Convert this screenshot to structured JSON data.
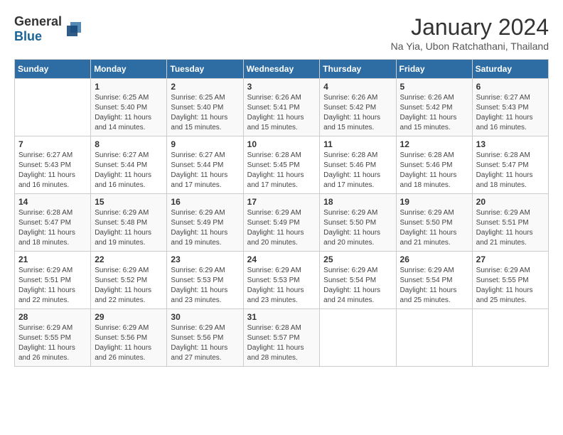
{
  "header": {
    "logo_general": "General",
    "logo_blue": "Blue",
    "title": "January 2024",
    "location": "Na Yia, Ubon Ratchathani, Thailand"
  },
  "calendar": {
    "days_of_week": [
      "Sunday",
      "Monday",
      "Tuesday",
      "Wednesday",
      "Thursday",
      "Friday",
      "Saturday"
    ],
    "weeks": [
      [
        {
          "day": "",
          "info": ""
        },
        {
          "day": "1",
          "info": "Sunrise: 6:25 AM\nSunset: 5:40 PM\nDaylight: 11 hours\nand 14 minutes."
        },
        {
          "day": "2",
          "info": "Sunrise: 6:25 AM\nSunset: 5:40 PM\nDaylight: 11 hours\nand 15 minutes."
        },
        {
          "day": "3",
          "info": "Sunrise: 6:26 AM\nSunset: 5:41 PM\nDaylight: 11 hours\nand 15 minutes."
        },
        {
          "day": "4",
          "info": "Sunrise: 6:26 AM\nSunset: 5:42 PM\nDaylight: 11 hours\nand 15 minutes."
        },
        {
          "day": "5",
          "info": "Sunrise: 6:26 AM\nSunset: 5:42 PM\nDaylight: 11 hours\nand 15 minutes."
        },
        {
          "day": "6",
          "info": "Sunrise: 6:27 AM\nSunset: 5:43 PM\nDaylight: 11 hours\nand 16 minutes."
        }
      ],
      [
        {
          "day": "7",
          "info": "Sunrise: 6:27 AM\nSunset: 5:43 PM\nDaylight: 11 hours\nand 16 minutes."
        },
        {
          "day": "8",
          "info": "Sunrise: 6:27 AM\nSunset: 5:44 PM\nDaylight: 11 hours\nand 16 minutes."
        },
        {
          "day": "9",
          "info": "Sunrise: 6:27 AM\nSunset: 5:44 PM\nDaylight: 11 hours\nand 17 minutes."
        },
        {
          "day": "10",
          "info": "Sunrise: 6:28 AM\nSunset: 5:45 PM\nDaylight: 11 hours\nand 17 minutes."
        },
        {
          "day": "11",
          "info": "Sunrise: 6:28 AM\nSunset: 5:46 PM\nDaylight: 11 hours\nand 17 minutes."
        },
        {
          "day": "12",
          "info": "Sunrise: 6:28 AM\nSunset: 5:46 PM\nDaylight: 11 hours\nand 18 minutes."
        },
        {
          "day": "13",
          "info": "Sunrise: 6:28 AM\nSunset: 5:47 PM\nDaylight: 11 hours\nand 18 minutes."
        }
      ],
      [
        {
          "day": "14",
          "info": "Sunrise: 6:28 AM\nSunset: 5:47 PM\nDaylight: 11 hours\nand 18 minutes."
        },
        {
          "day": "15",
          "info": "Sunrise: 6:29 AM\nSunset: 5:48 PM\nDaylight: 11 hours\nand 19 minutes."
        },
        {
          "day": "16",
          "info": "Sunrise: 6:29 AM\nSunset: 5:49 PM\nDaylight: 11 hours\nand 19 minutes."
        },
        {
          "day": "17",
          "info": "Sunrise: 6:29 AM\nSunset: 5:49 PM\nDaylight: 11 hours\nand 20 minutes."
        },
        {
          "day": "18",
          "info": "Sunrise: 6:29 AM\nSunset: 5:50 PM\nDaylight: 11 hours\nand 20 minutes."
        },
        {
          "day": "19",
          "info": "Sunrise: 6:29 AM\nSunset: 5:50 PM\nDaylight: 11 hours\nand 21 minutes."
        },
        {
          "day": "20",
          "info": "Sunrise: 6:29 AM\nSunset: 5:51 PM\nDaylight: 11 hours\nand 21 minutes."
        }
      ],
      [
        {
          "day": "21",
          "info": "Sunrise: 6:29 AM\nSunset: 5:51 PM\nDaylight: 11 hours\nand 22 minutes."
        },
        {
          "day": "22",
          "info": "Sunrise: 6:29 AM\nSunset: 5:52 PM\nDaylight: 11 hours\nand 22 minutes."
        },
        {
          "day": "23",
          "info": "Sunrise: 6:29 AM\nSunset: 5:53 PM\nDaylight: 11 hours\nand 23 minutes."
        },
        {
          "day": "24",
          "info": "Sunrise: 6:29 AM\nSunset: 5:53 PM\nDaylight: 11 hours\nand 23 minutes."
        },
        {
          "day": "25",
          "info": "Sunrise: 6:29 AM\nSunset: 5:54 PM\nDaylight: 11 hours\nand 24 minutes."
        },
        {
          "day": "26",
          "info": "Sunrise: 6:29 AM\nSunset: 5:54 PM\nDaylight: 11 hours\nand 25 minutes."
        },
        {
          "day": "27",
          "info": "Sunrise: 6:29 AM\nSunset: 5:55 PM\nDaylight: 11 hours\nand 25 minutes."
        }
      ],
      [
        {
          "day": "28",
          "info": "Sunrise: 6:29 AM\nSunset: 5:55 PM\nDaylight: 11 hours\nand 26 minutes."
        },
        {
          "day": "29",
          "info": "Sunrise: 6:29 AM\nSunset: 5:56 PM\nDaylight: 11 hours\nand 26 minutes."
        },
        {
          "day": "30",
          "info": "Sunrise: 6:29 AM\nSunset: 5:56 PM\nDaylight: 11 hours\nand 27 minutes."
        },
        {
          "day": "31",
          "info": "Sunrise: 6:28 AM\nSunset: 5:57 PM\nDaylight: 11 hours\nand 28 minutes."
        },
        {
          "day": "",
          "info": ""
        },
        {
          "day": "",
          "info": ""
        },
        {
          "day": "",
          "info": ""
        }
      ]
    ]
  }
}
